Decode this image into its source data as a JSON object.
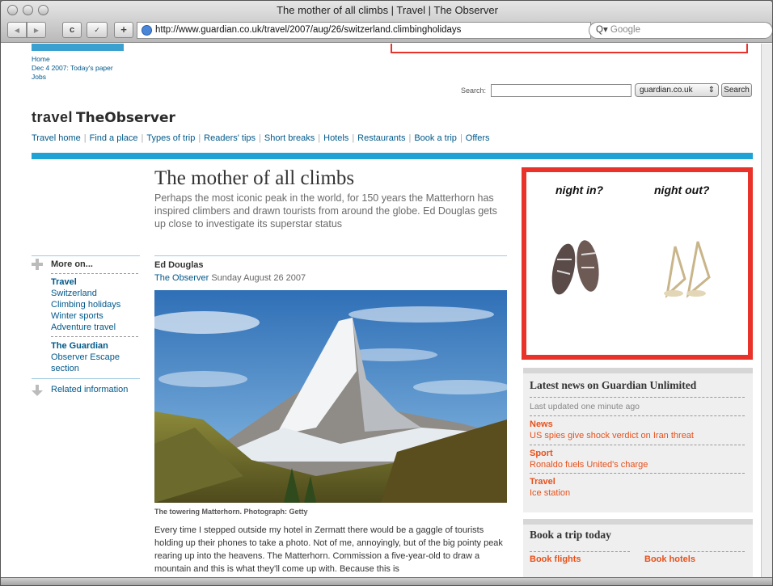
{
  "window": {
    "title": "The mother of all climbs | Travel | The Observer"
  },
  "toolbar": {
    "back": "◀",
    "forward": "▶",
    "reload": "c",
    "bookmark": "✓",
    "add": "+",
    "url": "http://www.guardian.co.uk/travel/2007/aug/26/switzerland.climbingholidays",
    "search_placeholder": "Google",
    "search_prefix": "Q▾"
  },
  "top_links": [
    "Home",
    "Dec 4 2007: Today's paper",
    "Jobs"
  ],
  "search": {
    "label": "Search:",
    "site": "guardian.co.uk",
    "button": "Search"
  },
  "brand": {
    "section": "travel",
    "paper": "TheObserver"
  },
  "nav": [
    "Travel home",
    "Find a place",
    "Types of trip",
    "Readers' tips",
    "Short breaks",
    "Hotels",
    "Restaurants",
    "Book a trip",
    "Offers"
  ],
  "article": {
    "headline": "The mother of all climbs",
    "standfirst": "Perhaps the most iconic peak in the world, for 150 years the Matterhorn has inspired climbers and drawn tourists from around the globe. Ed Douglas gets up close to investigate its superstar status",
    "author": "Ed Douglas",
    "publication": "The Observer",
    "date": "Sunday August 26 2007",
    "caption": "The towering Matterhorn. Photograph: Getty",
    "body": "Every time I stepped outside my hotel in Zermatt there would be a gaggle of tourists holding up their phones to take a photo. Not of me, annoyingly, but of the big pointy peak rearing up into the heavens. The Matterhorn. Commission a five-year-old to draw a mountain and this is what they'll come up with. Because this is"
  },
  "more_on": {
    "heading": "More on...",
    "groups": [
      {
        "title": "Travel",
        "items": [
          "Switzerland",
          "Climbing holidays",
          "Winter sports",
          "Adventure travel"
        ]
      },
      {
        "title": "The Guardian",
        "items": [
          "Observer Escape section"
        ]
      }
    ],
    "related": "Related information"
  },
  "ad": {
    "left": "night in?",
    "right": "night out?"
  },
  "news": {
    "heading": "Latest news on Guardian Unlimited",
    "updated": "Last updated one minute ago",
    "items": [
      {
        "section": "News",
        "headline": "US spies give shock verdict on Iran threat"
      },
      {
        "section": "Sport",
        "headline": "Ronaldo fuels United's charge"
      },
      {
        "section": "Travel",
        "headline": "Ice station"
      }
    ]
  },
  "book": {
    "heading": "Book a trip today",
    "flights": "Book flights",
    "hotels": "Book hotels"
  },
  "colors": {
    "accent": "#1fa2d4",
    "ad_border": "#e8322a",
    "news_link": "#e8501a"
  }
}
